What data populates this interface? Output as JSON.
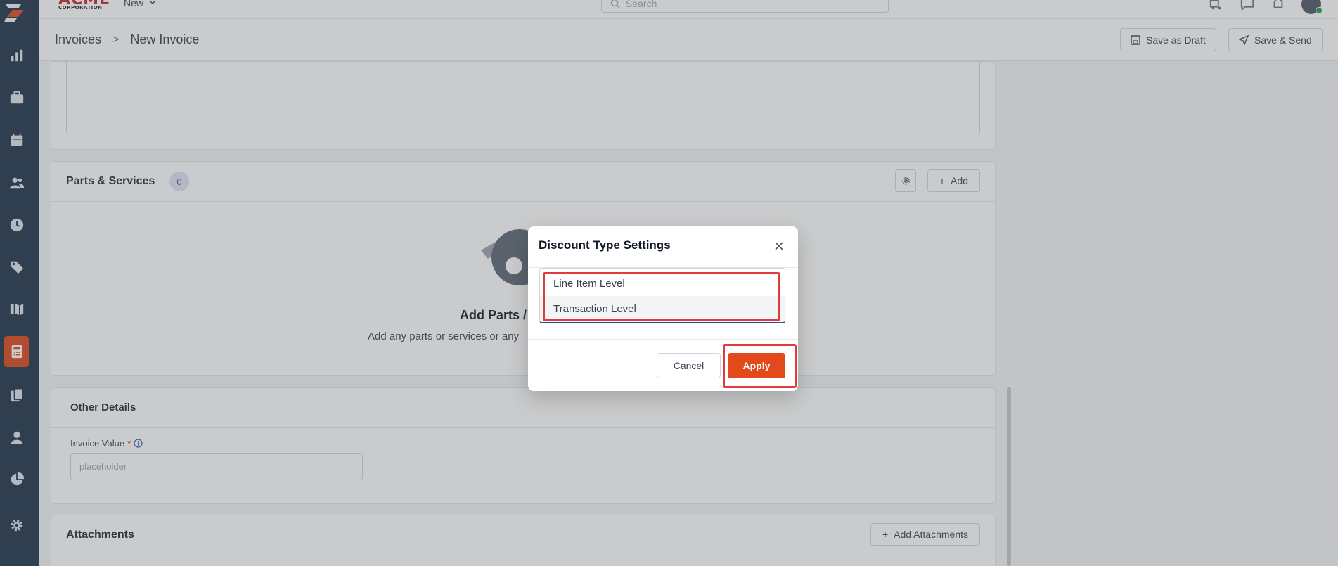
{
  "brand": {
    "name_top": "ACME",
    "name_bottom": "CORPORATION"
  },
  "topbar": {
    "new_label": "New",
    "search_placeholder": "Search"
  },
  "sidebar": {
    "items": [
      {
        "icon": "bar-chart-icon"
      },
      {
        "icon": "briefcase-icon"
      },
      {
        "icon": "calendar-icon"
      },
      {
        "icon": "users-icon"
      },
      {
        "icon": "clock-icon"
      },
      {
        "icon": "tag-icon"
      },
      {
        "icon": "map-icon"
      },
      {
        "icon": "calculator-icon",
        "active": true
      },
      {
        "icon": "documents-icon"
      },
      {
        "icon": "user-icon"
      },
      {
        "icon": "pie-chart-icon"
      },
      {
        "icon": "gear-icon"
      }
    ]
  },
  "header": {
    "breadcrumb": [
      "Invoices",
      "New Invoice"
    ],
    "separator": ">",
    "save_draft_label": "Save as Draft",
    "save_send_label": "Save & Send"
  },
  "parts": {
    "title": "Parts & Services",
    "count": "0",
    "add_label": "Add",
    "empty_title": "Add Parts /",
    "empty_subtitle": "Add any parts or services or any"
  },
  "other": {
    "title": "Other Details",
    "invoice_value_label": "Invoice Value",
    "required_mark": "*",
    "invoice_value_placeholder": "placeholder"
  },
  "attachments": {
    "title": "Attachments",
    "add_label": "Add Attachments"
  },
  "modal": {
    "title": "Discount Type Settings",
    "options": [
      "Line Item Level",
      "Transaction Level"
    ],
    "cancel_label": "Cancel",
    "apply_label": "Apply"
  },
  "colors": {
    "sidebar_bg": "#1b3249",
    "accent": "#e2491b",
    "highlight": "#e33a3e"
  }
}
